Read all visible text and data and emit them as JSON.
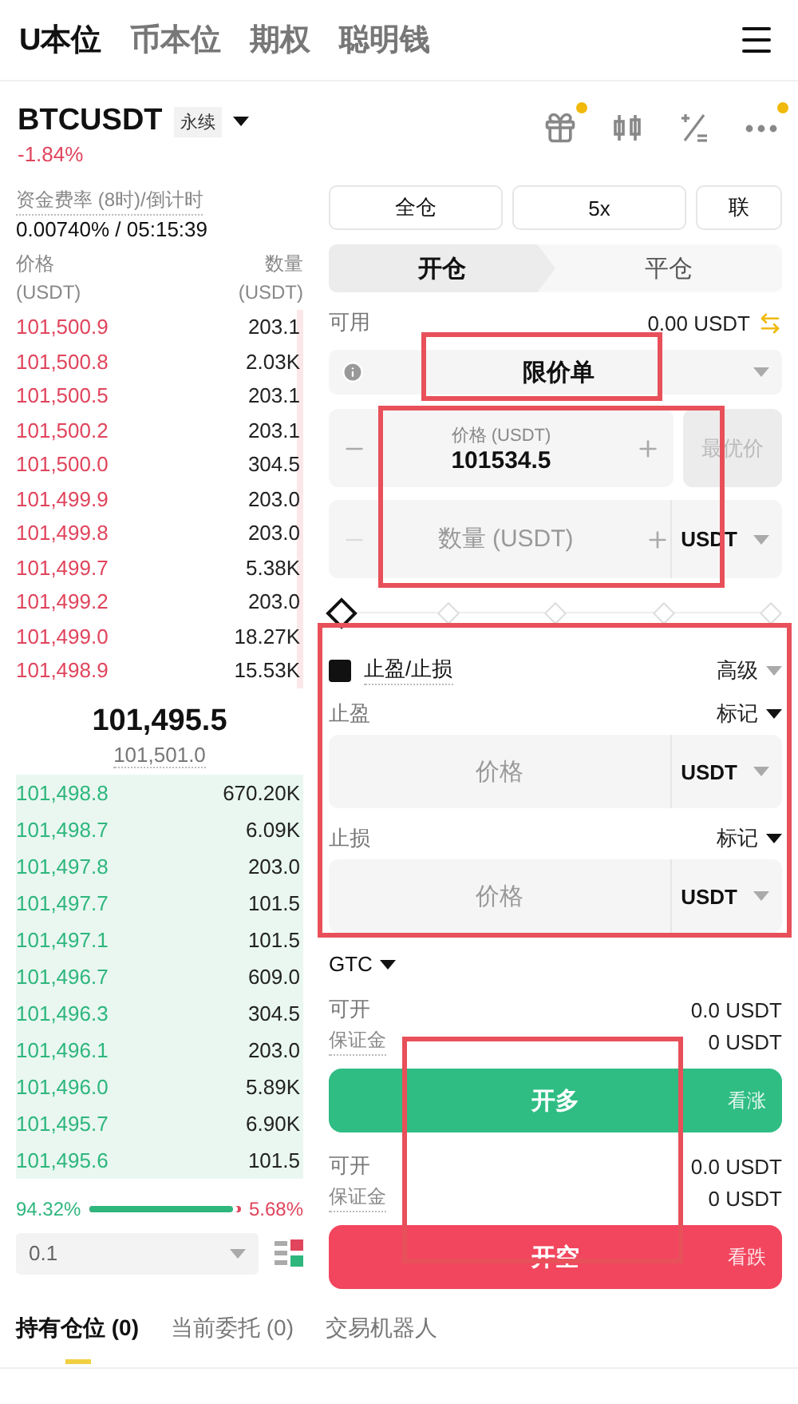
{
  "top_tabs": [
    {
      "label": "U本位",
      "selected": true
    },
    {
      "label": "币本位",
      "selected": false
    },
    {
      "label": "期权",
      "selected": false
    },
    {
      "label": "聪明钱",
      "selected": false
    }
  ],
  "symbol": {
    "name": "BTCUSDT",
    "tag": "永续",
    "change": "-1.84%"
  },
  "toolbar": [
    {
      "kind": "gift",
      "badge": true
    },
    {
      "kind": "candles",
      "badge": false
    },
    {
      "kind": "calc",
      "badge": false
    },
    {
      "kind": "more",
      "badge": true
    }
  ],
  "funding": {
    "label": "资金费率 (8时)/倒计时",
    "value": "0.00740% / 05:15:39"
  },
  "orderbook": {
    "price_header": [
      "价格",
      "(USDT)"
    ],
    "qty_header": [
      "数量",
      "(USDT)"
    ],
    "asks": [
      {
        "price": "101,500.9",
        "qty": "203.1"
      },
      {
        "price": "101,500.8",
        "qty": "2.03K"
      },
      {
        "price": "101,500.5",
        "qty": "203.1"
      },
      {
        "price": "101,500.2",
        "qty": "203.1"
      },
      {
        "price": "101,500.0",
        "qty": "304.5"
      },
      {
        "price": "101,499.9",
        "qty": "203.0"
      },
      {
        "price": "101,499.8",
        "qty": "203.0"
      },
      {
        "price": "101,499.7",
        "qty": "5.38K"
      },
      {
        "price": "101,499.2",
        "qty": "203.0"
      },
      {
        "price": "101,499.0",
        "qty": "18.27K"
      },
      {
        "price": "101,498.9",
        "qty": "15.53K"
      }
    ],
    "last_price": "101,495.5",
    "mark_price": "101,501.0",
    "bids": [
      {
        "price": "101,498.8",
        "qty": "670.20K"
      },
      {
        "price": "101,498.7",
        "qty": "6.09K"
      },
      {
        "price": "101,497.8",
        "qty": "203.0"
      },
      {
        "price": "101,497.7",
        "qty": "101.5"
      },
      {
        "price": "101,497.1",
        "qty": "101.5"
      },
      {
        "price": "101,496.7",
        "qty": "609.0"
      },
      {
        "price": "101,496.3",
        "qty": "304.5"
      },
      {
        "price": "101,496.1",
        "qty": "203.0"
      },
      {
        "price": "101,496.0",
        "qty": "5.89K"
      },
      {
        "price": "101,495.7",
        "qty": "6.90K"
      },
      {
        "price": "101,495.6",
        "qty": "101.5"
      }
    ],
    "buy_ratio": "94.32%",
    "sell_ratio": "5.68%",
    "level": 0.9432,
    "precision": "0.1"
  },
  "margin_buttons": [
    "全仓",
    "5x",
    "联"
  ],
  "side_tabs": [
    {
      "label": "开仓",
      "selected": true
    },
    {
      "label": "平仓",
      "selected": false
    }
  ],
  "available": {
    "label": "可用",
    "value": "0.00 USDT"
  },
  "order_type": {
    "label": "限价单",
    "highlighted": true
  },
  "price_field": {
    "label": "价格 (USDT)",
    "value": "101534.5",
    "best_price": "最优价"
  },
  "amount_field": {
    "placeholder": "数量 (USDT)",
    "unit": "USDT"
  },
  "fields_highlighted": true,
  "slider": {
    "level": 0
  },
  "tpsl": {
    "label": "止盈/止损",
    "checked": true,
    "mode": "高级",
    "highlighted": true,
    "rows": [
      {
        "label": "止盈",
        "trigger": "标记",
        "placeholder": "价格",
        "unit": "USDT"
      },
      {
        "label": "止损",
        "trigger": "标记",
        "placeholder": "价格",
        "unit": "USDT"
      }
    ]
  },
  "time_in_force": "GTC",
  "long": {
    "rows": [
      {
        "label": "可开",
        "value": "0.0 USDT"
      },
      {
        "label": "保证金",
        "value": "0 USDT"
      }
    ],
    "button": "开多",
    "hint": "看涨"
  },
  "short": {
    "rows": [
      {
        "label": "可开",
        "value": "0.0 USDT"
      },
      {
        "label": "保证金",
        "value": "0 USDT"
      }
    ],
    "button": "开空",
    "hint": "看跌"
  },
  "actions_highlighted": true,
  "bottom_tabs": [
    {
      "label": "持有仓位 (0)",
      "selected": true
    },
    {
      "label": "当前委托 (0)",
      "selected": false
    },
    {
      "label": "交易机器人",
      "selected": false
    }
  ]
}
